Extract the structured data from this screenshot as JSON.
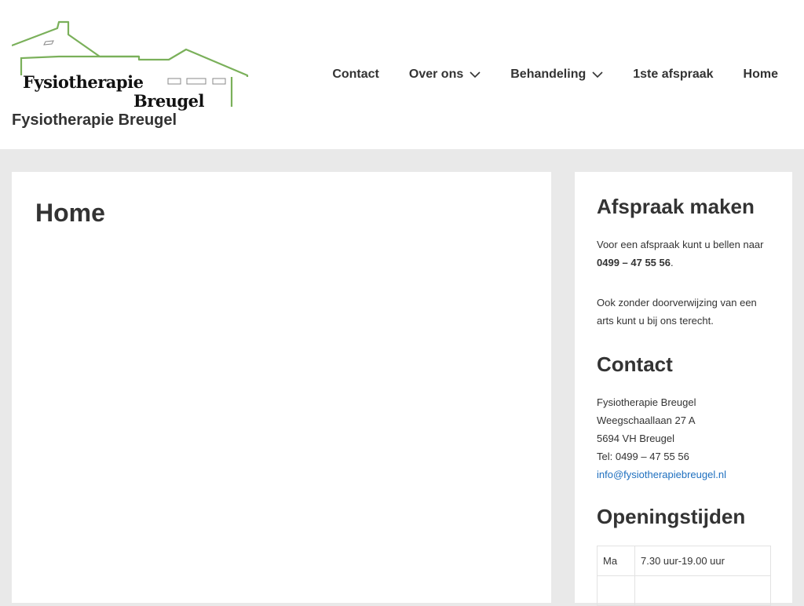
{
  "header": {
    "logo": {
      "line1": "Fysiotherapie",
      "line2": "Breugel",
      "brand_color": "#7ab05a",
      "icon": "house-roof-logo"
    },
    "site_title": "Fysiotherapie Breugel"
  },
  "nav": {
    "items": [
      {
        "label": "Contact",
        "has_dropdown": false
      },
      {
        "label": "Over ons",
        "has_dropdown": true,
        "icon": "chevron-down-icon"
      },
      {
        "label": "Behandeling",
        "has_dropdown": true,
        "icon": "chevron-down-icon"
      },
      {
        "label": "1ste afspraak",
        "has_dropdown": false
      },
      {
        "label": "Home",
        "has_dropdown": false
      }
    ]
  },
  "main": {
    "title": "Home"
  },
  "sidebar": {
    "appointment": {
      "title": "Afspraak maken",
      "text1": "Voor een afspraak kunt u bellen naar",
      "phone": "0499 – 47 55 56",
      "period": ".",
      "text2": "Ook zonder doorverwijzing van een arts kunt u bij ons terecht."
    },
    "contact": {
      "title": "Contact",
      "name": "Fysiotherapie Breugel",
      "street": "Weegschaallaan 27 A",
      "city": "5694 VH Breugel",
      "tel": "Tel: 0499 – 47 55 56",
      "email": "info@fysiotherapiebreugel.nl"
    },
    "hours": {
      "title": "Openingstijden",
      "rows": [
        {
          "day": "Ma",
          "time": "7.30 uur-19.00 uur"
        },
        {
          "day": "",
          "time": ""
        }
      ]
    }
  },
  "colors": {
    "background": "#e9e9e9",
    "text": "#333333",
    "link": "#1e6fbf",
    "logo_green": "#7ab05a"
  }
}
